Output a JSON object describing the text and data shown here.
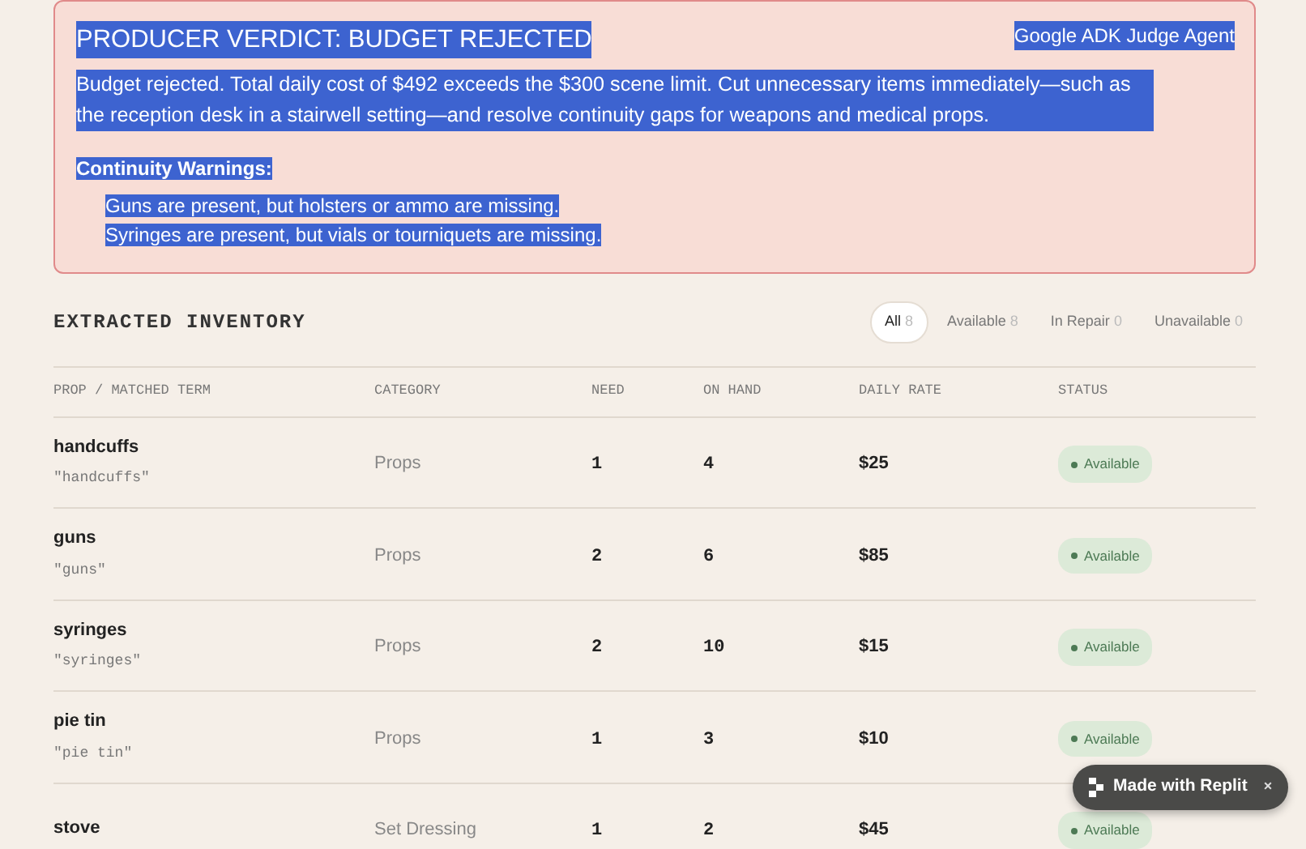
{
  "verdict": {
    "title": "PRODUCER VERDICT: BUDGET REJECTED",
    "agent": "Google ADK Judge Agent",
    "text_selected": true,
    "message": "Budget rejected. Total daily cost of $492 exceeds the $300 scene limit. Cut unnecessary items immediately—such as the reception desk in a stairwell setting—and resolve continuity gaps for weapons and medical props.",
    "warnings_heading": "Continuity Warnings:",
    "warnings": [
      "Guns are present, but holsters or ammo are missing.",
      "Syringes are present, but vials or tourniquets are missing."
    ]
  },
  "inventory": {
    "title": "EXTRACTED INVENTORY",
    "filters": [
      {
        "label": "All",
        "count": "8",
        "selected": true
      },
      {
        "label": "Available",
        "count": "8",
        "selected": false
      },
      {
        "label": "In Repair",
        "count": "0",
        "selected": false
      },
      {
        "label": "Unavailable",
        "count": "0",
        "selected": false
      }
    ],
    "columns": [
      "PROP / MATCHED TERM",
      "CATEGORY",
      "NEED",
      "ON HAND",
      "DAILY RATE",
      "STATUS"
    ],
    "rows": [
      {
        "prop": "handcuffs",
        "term": "\"handcuffs\"",
        "category": "Props",
        "need": "1",
        "on_hand": "4",
        "rate": "$25",
        "status": "Available"
      },
      {
        "prop": "guns",
        "term": "\"guns\"",
        "category": "Props",
        "need": "2",
        "on_hand": "6",
        "rate": "$85",
        "status": "Available"
      },
      {
        "prop": "syringes",
        "term": "\"syringes\"",
        "category": "Props",
        "need": "2",
        "on_hand": "10",
        "rate": "$15",
        "status": "Available"
      },
      {
        "prop": "pie tin",
        "term": "\"pie tin\"",
        "category": "Props",
        "need": "1",
        "on_hand": "3",
        "rate": "$10",
        "status": "Available"
      },
      {
        "prop": "stove",
        "category": "Set Dressing",
        "need": "1",
        "on_hand": "2",
        "rate": "$45",
        "status": "Available"
      }
    ]
  },
  "badge": {
    "label": "Made with Replit",
    "close": "×"
  }
}
